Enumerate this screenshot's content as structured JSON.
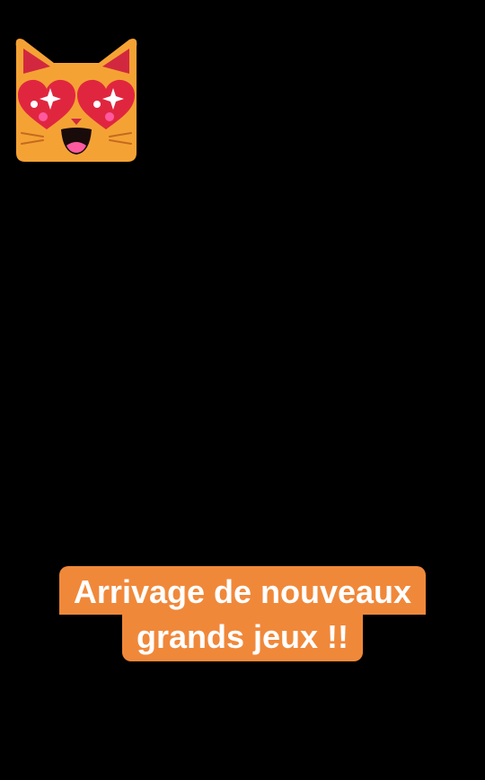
{
  "caption": {
    "lines": [
      "Arrivage de nouveaux",
      "grands jeux !!"
    ],
    "background_color": "#f0883a",
    "text_color": "#ffffff"
  },
  "sticker": {
    "icon": "heart-eyes-cat-icon",
    "fill_color": "#f5a235",
    "heart_color": "#e0263f"
  },
  "background_color": "#000000"
}
